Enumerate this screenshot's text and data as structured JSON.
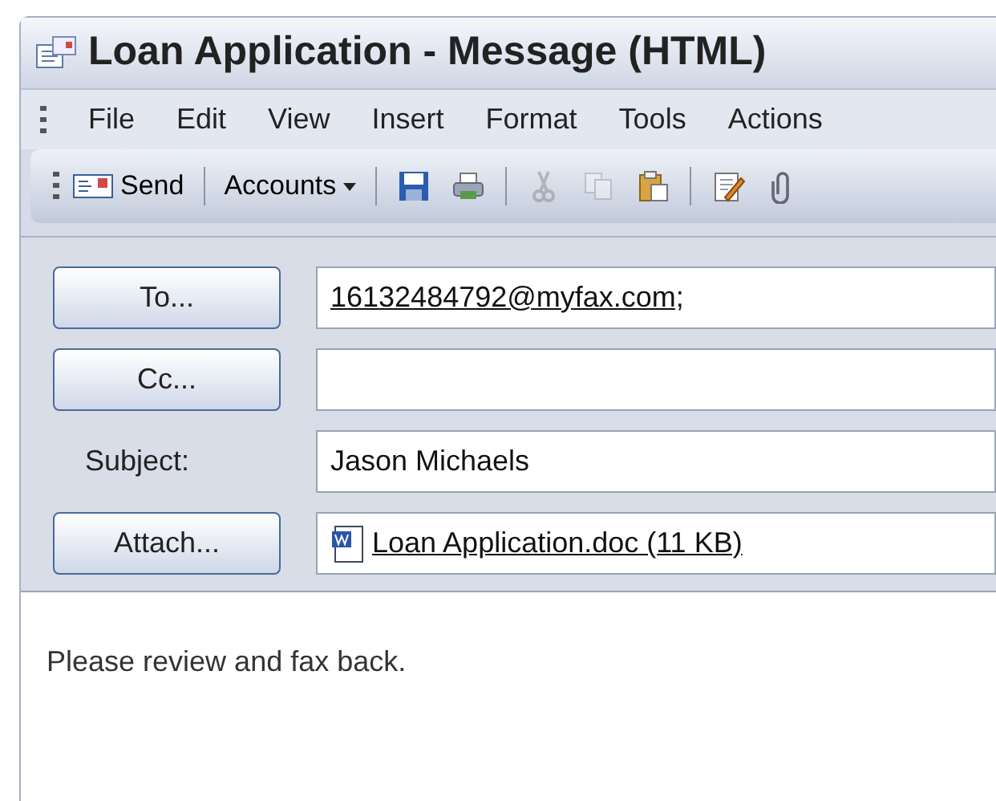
{
  "window": {
    "title": "Loan Application - Message (HTML)"
  },
  "menu": [
    {
      "label": "File"
    },
    {
      "label": "Edit"
    },
    {
      "label": "View"
    },
    {
      "label": "Insert"
    },
    {
      "label": "Format"
    },
    {
      "label": "Tools"
    },
    {
      "label": "Actions"
    }
  ],
  "toolbar": [
    {
      "kind": "send",
      "label": "Send",
      "disabled": false
    },
    {
      "kind": "separator"
    },
    {
      "kind": "dropdown",
      "label": "Accounts",
      "disabled": false
    },
    {
      "kind": "separator"
    },
    {
      "kind": "save",
      "disabled": false
    },
    {
      "kind": "print",
      "disabled": false
    },
    {
      "kind": "separator"
    },
    {
      "kind": "cut",
      "disabled": true
    },
    {
      "kind": "copy",
      "disabled": true
    },
    {
      "kind": "paste",
      "disabled": false
    },
    {
      "kind": "separator"
    },
    {
      "kind": "edit",
      "disabled": false
    },
    {
      "kind": "attach",
      "disabled": false
    }
  ],
  "fields": [
    {
      "kind": "button",
      "label": "To...",
      "value": "16132484792@myfax.com;"
    },
    {
      "kind": "button",
      "label": "Cc..."
    },
    {
      "kind": "label",
      "label": "Subject:",
      "value": "Jason Michaels"
    },
    {
      "kind": "attachment",
      "label": "Attach...",
      "value": "Loan Application.doc (11 KB)"
    }
  ],
  "body": {
    "text": "Please review and fax back."
  }
}
